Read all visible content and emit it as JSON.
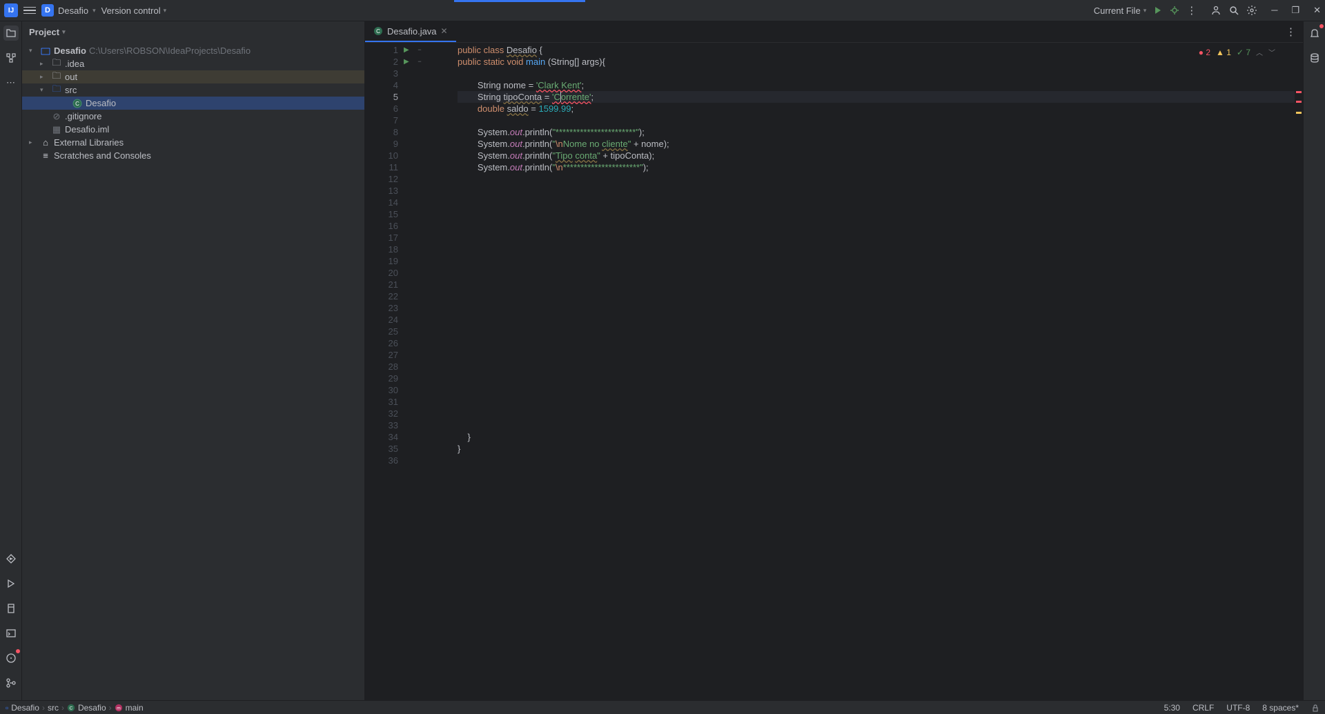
{
  "titlebar": {
    "project_name": "Desafio",
    "vcs_label": "Version control",
    "current_file_label": "Current File"
  },
  "project_panel": {
    "header": "Project",
    "root_name": "Desafio",
    "root_path": "C:\\Users\\ROBSON\\IdeaProjects\\Desafio",
    "items": {
      "idea": ".idea",
      "out": "out",
      "src": "src",
      "desafio_class": "Desafio",
      "gitignore": ".gitignore",
      "iml": "Desafio.iml",
      "ext_lib": "External Libraries",
      "scratches": "Scratches and Consoles"
    }
  },
  "tabs": {
    "file_tab": "Desafio.java"
  },
  "inspections": {
    "errors": "2",
    "warnings": "1",
    "ok": "7"
  },
  "code": {
    "l1_a": "public",
    "l1_b": "class",
    "l1_c": "Desafio",
    "l1_d": " {",
    "l2_a": "public",
    "l2_b": "static",
    "l2_c": "void",
    "l2_d": "main",
    "l2_e": " (String[] args){",
    "l4_a": "String nome = ",
    "l4_b": "'Clark Kent'",
    "l4_c": ";",
    "l5_a": "String ",
    "l5_b": "tipoConta",
    "l5_c": " = ",
    "l5_d": "'C",
    "l5_e": "orrente'",
    "l5_f": ";",
    "l6_a": "double",
    "l6_b": " ",
    "l6_c": "saldo",
    "l6_d": " = ",
    "l6_e": "1599.99",
    "l6_f": ";",
    "l8_a": "System.",
    "l8_b": "out",
    "l8_c": ".println(",
    "l8_d": "\"***********************\"",
    "l8_e": ");",
    "l9_a": "System.",
    "l9_b": "out",
    "l9_c": ".println(",
    "l9_d": "\"",
    "l9_e": "\\n",
    "l9_f": "Nome no ",
    "l9_g": "cliente",
    "l9_h": "\"",
    "l9_i": " + nome);",
    "l10_a": "System.",
    "l10_b": "out",
    "l10_c": ".println(",
    "l10_d": "\"",
    "l10_e": "Tipo",
    "l10_f": " ",
    "l10_g": "conta",
    "l10_h": "\"",
    "l10_i": " + tipoConta);",
    "l11_a": "System.",
    "l11_b": "out",
    "l11_c": ".println(",
    "l11_d": "\"",
    "l11_e": "\\n",
    "l11_f": "**********************\"",
    "l11_g": ");",
    "l34": "    }",
    "l35": "}"
  },
  "breadcrumb": {
    "project": "Desafio",
    "src": "src",
    "class": "Desafio",
    "method": "main"
  },
  "status": {
    "position": "5:30",
    "line_sep": "CRLF",
    "encoding": "UTF-8",
    "indent": "8 spaces*"
  }
}
